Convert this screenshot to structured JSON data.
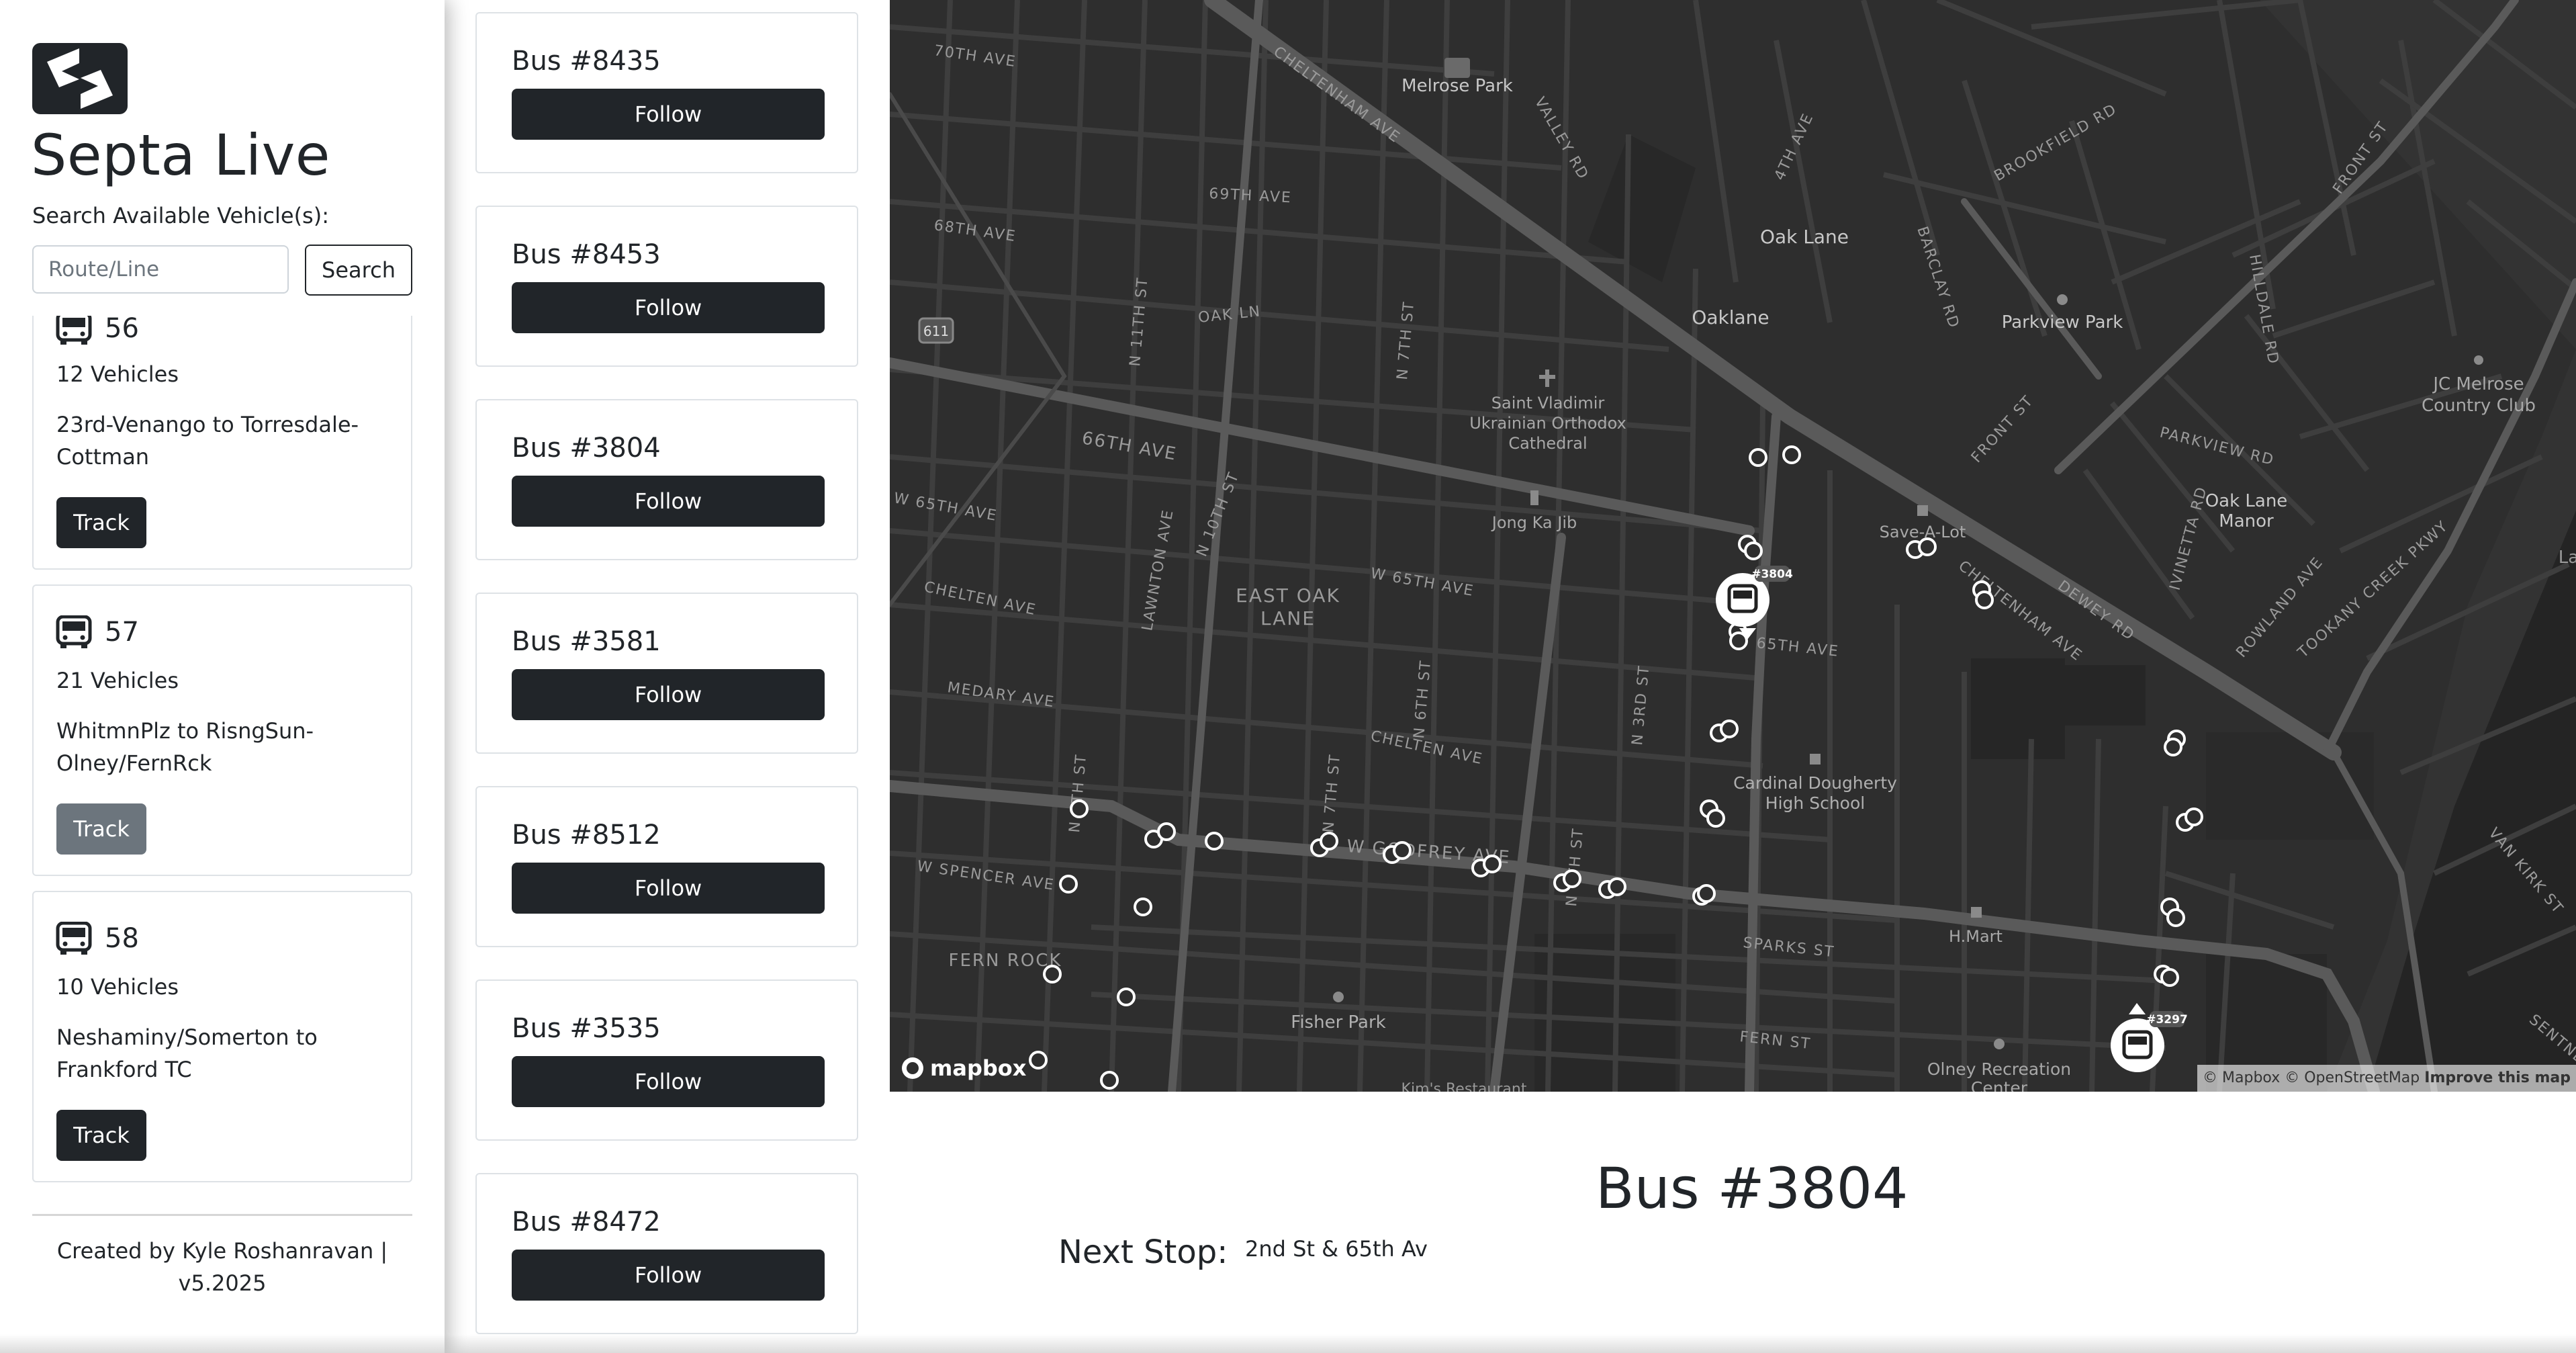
{
  "app": {
    "title": "Septa Live",
    "search_label": "Search Available Vehicle(s):",
    "search_placeholder": "Route/Line",
    "search_button": "Search",
    "footer": "Created by Kyle Roshanravan | v5.2025"
  },
  "routes": [
    {
      "number": "56",
      "vehicles": "12 Vehicles",
      "description": "23rd-Venango to Torresdale-Cottman",
      "button": "Track",
      "state": "enabled"
    },
    {
      "number": "57",
      "vehicles": "21 Vehicles",
      "description": "WhitmnPlz to RisngSun-Olney/FernRck",
      "button": "Track",
      "state": "active"
    },
    {
      "number": "58",
      "vehicles": "10 Vehicles",
      "description": "Neshaminy/Somerton to Frankford TC",
      "button": "Track",
      "state": "enabled"
    }
  ],
  "vehicles": [
    {
      "title": "Bus #8435",
      "button": "Follow"
    },
    {
      "title": "Bus #8453",
      "button": "Follow"
    },
    {
      "title": "Bus #3804",
      "button": "Follow"
    },
    {
      "title": "Bus #3581",
      "button": "Follow"
    },
    {
      "title": "Bus #8512",
      "button": "Follow"
    },
    {
      "title": "Bus #3535",
      "button": "Follow"
    },
    {
      "title": "Bus #8472",
      "button": "Follow"
    }
  ],
  "map": {
    "labels": {
      "melrose_park": "Melrose Park",
      "oak_lane": "Oak Lane",
      "oaklane": "Oaklane",
      "parkview_park": "Parkview Park",
      "jc_melrose": "JC Melrose",
      "country_club": "Country Club",
      "saint_vladimir_1": "Saint Vladimir",
      "saint_vladimir_2": "Ukrainian Orthodox",
      "saint_vladimir_3": "Cathedral",
      "jong_ka_jib": "Jong Ka Jib",
      "save_a_lot": "Save-A-Lot",
      "oak_lane_manor_1": "Oak Lane",
      "oak_lane_manor_2": "Manor",
      "east_oak_lane_1": "EAST OAK",
      "east_oak_lane_2": "LANE",
      "cardinal_1": "Cardinal Dougherty",
      "cardinal_2": "High School",
      "h_mart": "H.Mart",
      "fisher_park": "Fisher Park",
      "olney_rec_1": "Olney Recreation",
      "olney_rec_2": "Center",
      "fern_rock": "FERN ROCK",
      "kims": "Kim's Restaurant",
      "route_611": "611",
      "s_70th": "70TH AVE",
      "s_69th": "69TH AVE",
      "s_68th": "68TH AVE",
      "s_66th": "66TH AVE",
      "s_w65th": "W 65TH AVE",
      "s_chelten": "CHELTEN AVE",
      "s_medary": "MEDARY AVE",
      "s_w_spencer": "W SPENCER AVE",
      "s_oak_ln": "OAK LN",
      "s_n11th": "N 11TH ST",
      "s_n7th": "N 7TH ST",
      "s_lawnton": "LAWNTON AVE",
      "s_n10th": "N 10TH ST",
      "s_w65th_2": "W 65TH AVE",
      "s_chelten_2": "CHELTEN AVE",
      "s_n6th": "N 6TH ST",
      "s_n3rd": "N 3RD ST",
      "s_cheltenham": "CHELTENHAM AVE",
      "s_valley": "VALLEY RD",
      "s_4th": "4TH AVE",
      "s_barclay": "BARCLAY RD",
      "s_brookfield": "BROOKFIELD RD",
      "s_front": "FRONT ST",
      "s_front_2": "FRONT ST",
      "s_hilldale": "HILLDALE RD",
      "s_parkview": "PARKVIEW RD",
      "s_dewey": "DEWEY RD",
      "s_cheltenham_2": "CHELTENHAM AVE",
      "s_ivinetta": "IVINETTA RD",
      "s_rowland": "ROWLAND AVE",
      "s_tookany": "TOOKANY CREEK PKWY",
      "s_sparks": "SPARKS ST",
      "s_fern": "FERN ST",
      "s_van_kirk": "VAN KIRK ST",
      "s_sentner": "SENTNER",
      "s_65th_av": "65TH AVE",
      "s_godfrey": "W GODFREY AVE",
      "s_n7th_2": "N 7TH ST",
      "s_n5th": "N 5TH ST",
      "s_n4th": "N 4TH ST",
      "s_la": "La"
    },
    "markers": [
      {
        "label": "#3804"
      },
      {
        "label": "#3297"
      }
    ],
    "attribution": "© Mapbox © OpenStreetMap",
    "improve": "Improve this map",
    "logo": "mapbox"
  },
  "detail": {
    "title": "Bus #3804",
    "next_stop_label": "Next Stop:",
    "next_stop_value": "2nd St & 65th Av"
  }
}
